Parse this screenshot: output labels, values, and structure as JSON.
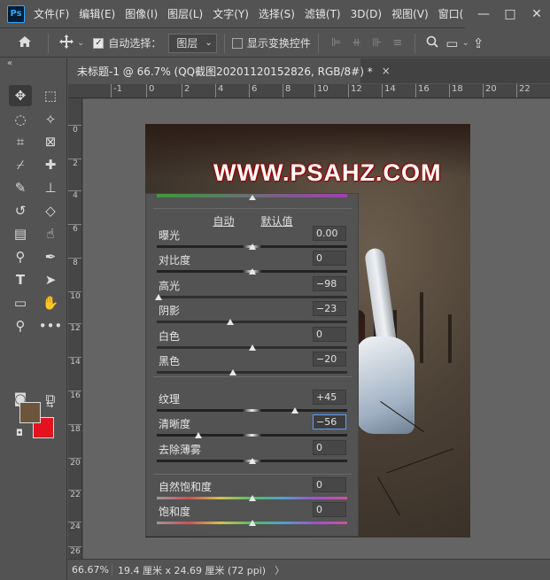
{
  "app": {
    "logo": "Ps",
    "window_controls": [
      "—",
      "□",
      "✕"
    ]
  },
  "menu": [
    "文件(F)",
    "编辑(E)",
    "图像(I)",
    "图层(L)",
    "文字(Y)",
    "选择(S)",
    "滤镜(T)",
    "3D(D)",
    "视图(V)",
    "窗口("
  ],
  "options": {
    "home_icon": "home-icon",
    "move_icon": "move-icon",
    "auto_select_label": "自动选择：",
    "auto_select_checked": true,
    "target_value": "图层",
    "show_transform_label": "显示变换控件",
    "show_transform_checked": false
  },
  "document": {
    "tab_title": "未标题-1 @ 66.7% (QQ截图20201120152826, RGB/8#) *",
    "close_label": "×",
    "watermark": "WWW.PSAHZ.COM"
  },
  "ruler_h": [
    "-1",
    "0",
    "2",
    "4",
    "6",
    "8",
    "10",
    "12",
    "14",
    "16",
    "18",
    "20",
    "22"
  ],
  "ruler_v": [
    "0",
    "2",
    "4",
    "6",
    "8",
    "10",
    "12",
    "14",
    "16",
    "18",
    "20",
    "22",
    "24",
    "26"
  ],
  "colors": {
    "foreground": "#6b563c",
    "background": "#e4121f"
  },
  "panel": {
    "tab_auto": "自动",
    "tab_default": "默认值",
    "rows": [
      {
        "label": "曝光",
        "value": "0.00",
        "position": 0.5
      },
      {
        "label": "对比度",
        "value": "0",
        "position": 0.5
      },
      {
        "label": "高光",
        "value": "−98",
        "position": 0.01
      },
      {
        "label": "阴影",
        "value": "−23",
        "position": 0.385
      },
      {
        "label": "白色",
        "value": "0",
        "position": 0.5
      },
      {
        "label": "黑色",
        "value": "−20",
        "position": 0.4
      },
      {
        "label": "纹理",
        "value": "+45",
        "position": 0.725
      },
      {
        "label": "清晰度",
        "value": "−56",
        "position": 0.22
      },
      {
        "label": "去除薄雾",
        "value": "0",
        "position": 0.5
      },
      {
        "label": "自然饱和度",
        "value": "0",
        "position": 0.5
      },
      {
        "label": "饱和度",
        "value": "0",
        "position": 0.5
      }
    ]
  },
  "status": {
    "zoom": "66.67%",
    "doc_info": "19.4 厘米 x 24.69 厘米 (72 ppi)",
    "arrow": "〉"
  }
}
